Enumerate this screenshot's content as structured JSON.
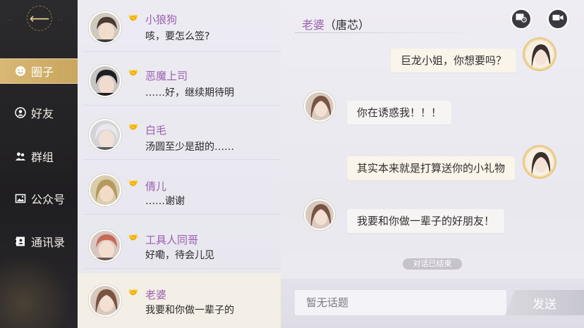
{
  "nav": {
    "items": [
      {
        "label": "圈子",
        "icon": "smiley-icon"
      },
      {
        "label": "好友",
        "icon": "user-circle-icon"
      },
      {
        "label": "群组",
        "icon": "group-icon"
      },
      {
        "label": "公众号",
        "icon": "image-icon"
      },
      {
        "label": "通讯录",
        "icon": "contacts-icon"
      }
    ],
    "active_index": 0,
    "accent": "#d3b26c"
  },
  "conversations": [
    {
      "name": "小狼狗",
      "message": "咳，要怎么签?"
    },
    {
      "name": "恶魔上司",
      "message": "……好，继续期待明"
    },
    {
      "name": "白毛",
      "message": "汤圆至少是甜的……"
    },
    {
      "name": "倩儿",
      "message": "……谢谢"
    },
    {
      "name": "工具人同哥",
      "message": "好嘞，待会儿见"
    },
    {
      "name": "老婆",
      "message": "我要和你做一辈子的"
    }
  ],
  "chat": {
    "title_name": "老婆",
    "title_sub": "（唐芯）",
    "messages": [
      {
        "side": "right",
        "text": "巨龙小姐，你想要吗？"
      },
      {
        "side": "left",
        "text": "你在诱惑我！！！"
      },
      {
        "side": "right",
        "text": "其实本来就是打算送你的小礼物"
      },
      {
        "side": "left",
        "text": "我要和你做一辈子的好朋友！"
      }
    ],
    "ended_label": "对话已结束"
  },
  "input": {
    "placeholder": "暂无话题",
    "send_label": "发送"
  }
}
